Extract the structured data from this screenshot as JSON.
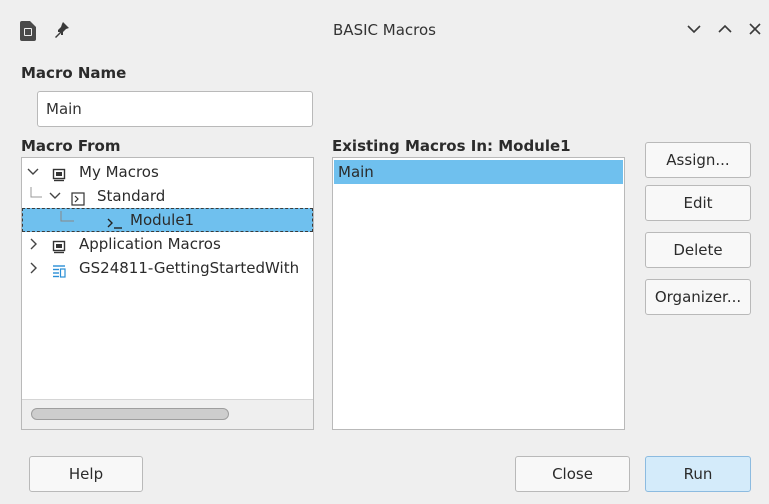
{
  "window": {
    "title": "BASIC Macros",
    "icons": [
      "app-icon",
      "pin-icon",
      "minimize-icon",
      "maximize-icon",
      "close-icon"
    ]
  },
  "macro_name": {
    "label": "Macro Name",
    "value": "Main"
  },
  "macro_from": {
    "label": "Macro From",
    "tree": [
      {
        "label": "My Macros",
        "expanded": true,
        "icon": "computer-icon"
      },
      {
        "label": "Standard",
        "expanded": true,
        "icon": "library-icon"
      },
      {
        "label": "Module1",
        "selected": true,
        "icon": "module-icon"
      },
      {
        "label": "Application Macros",
        "expanded": false,
        "icon": "computer-icon"
      },
      {
        "label": "GS24811-GettingStartedWith",
        "expanded": false,
        "icon": "document-icon"
      }
    ]
  },
  "existing": {
    "label": "Existing Macros In: Module1",
    "items": [
      "Main"
    ]
  },
  "buttons": {
    "assign": "Assign...",
    "edit": "Edit",
    "delete": "Delete",
    "organizer": "Organizer...",
    "help": "Help",
    "close": "Close",
    "run": "Run"
  },
  "colors": {
    "selection": "#6fc0ee",
    "background": "#efefef",
    "primary_button": "#d4ebfa"
  }
}
